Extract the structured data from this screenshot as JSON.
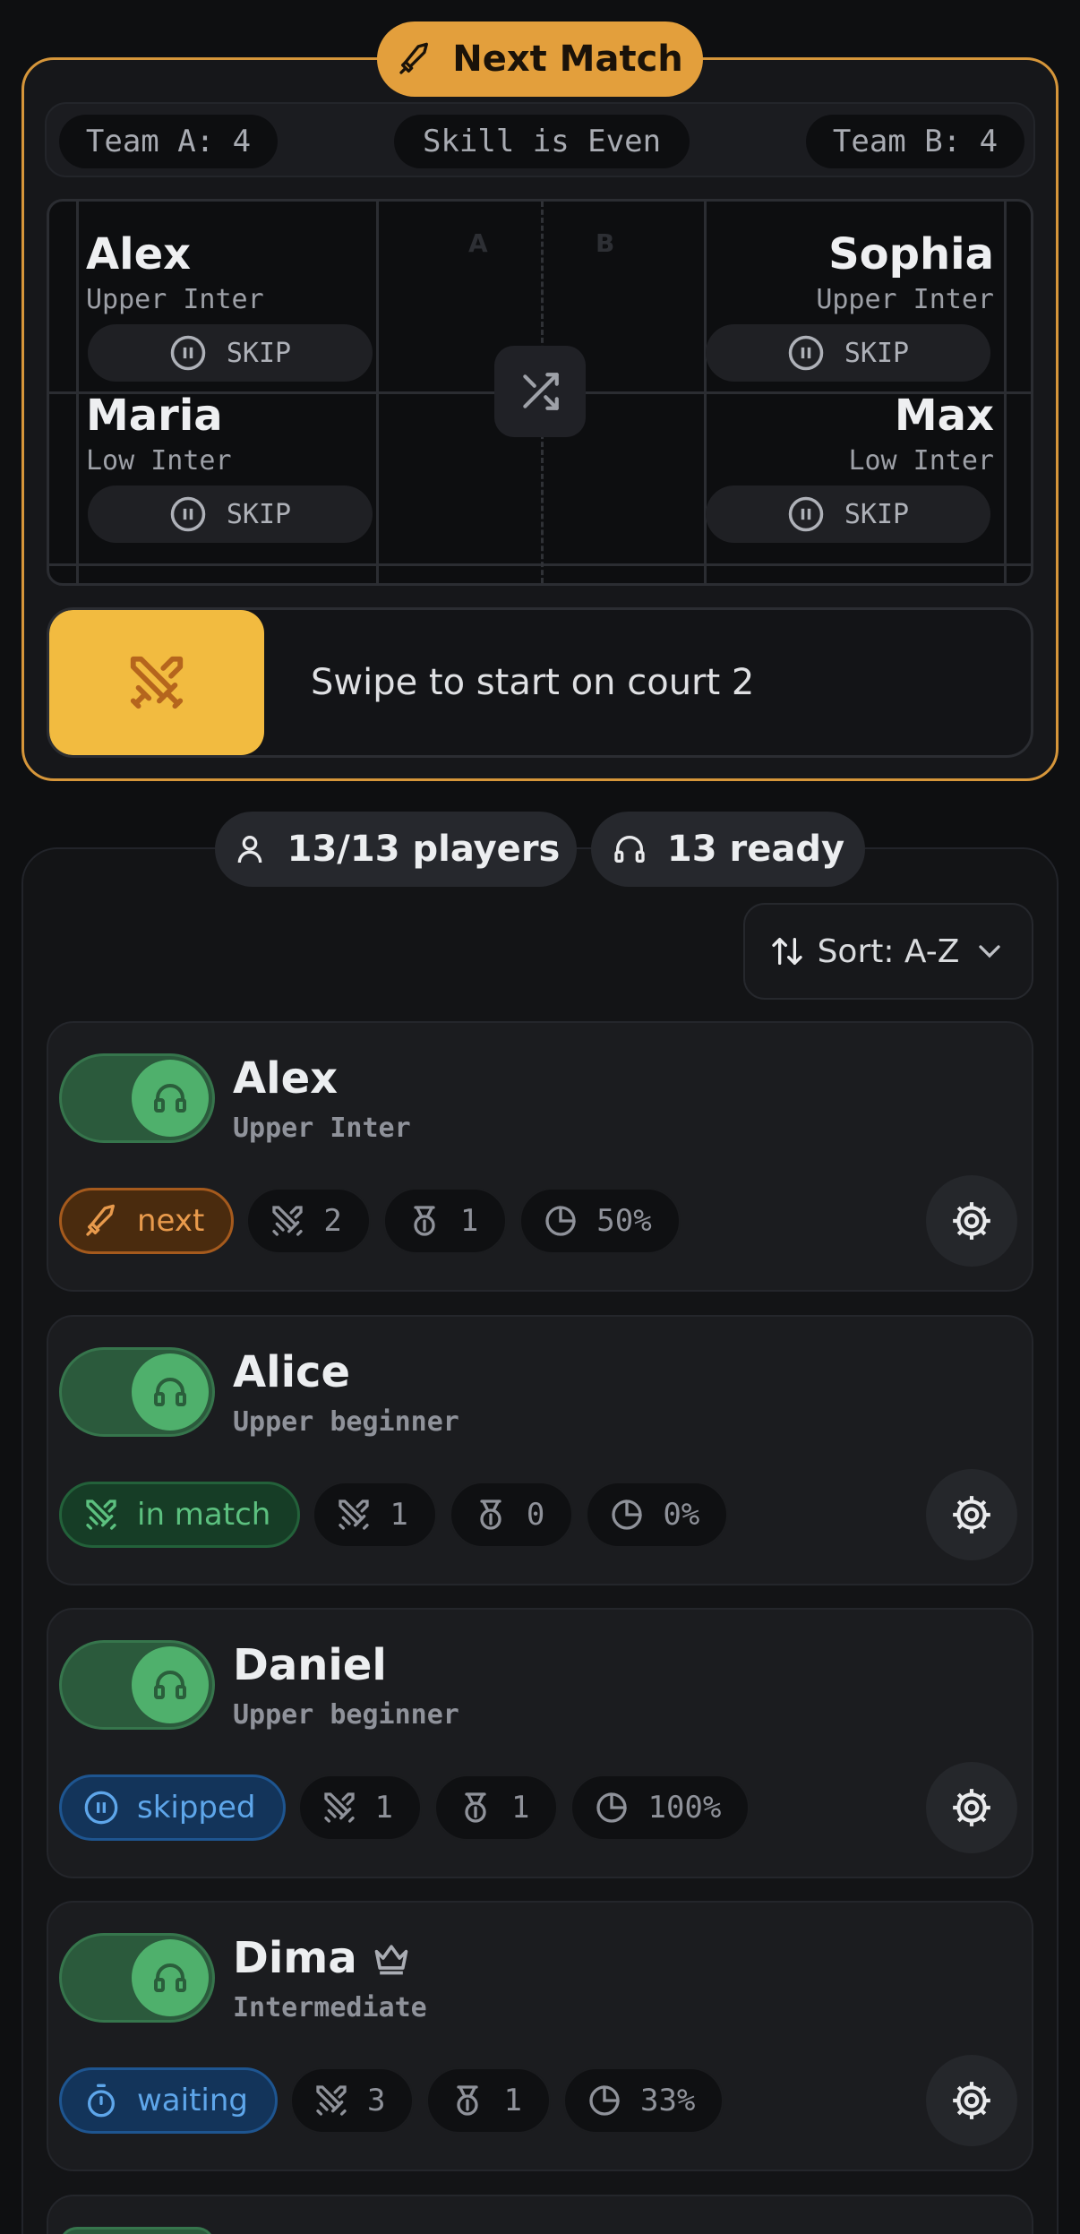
{
  "match": {
    "title": "Next Match",
    "team_a": "Team A: 4",
    "balance": "Skill is Even",
    "team_b": "Team B: 4",
    "court_labels": [
      "A",
      "B"
    ],
    "left_players": [
      {
        "name": "Alex",
        "level": "Upper Inter",
        "skip": "SKIP"
      },
      {
        "name": "Maria",
        "level": "Low Inter",
        "skip": "SKIP"
      }
    ],
    "right_players": [
      {
        "name": "Sophia",
        "level": "Upper Inter",
        "skip": "SKIP"
      },
      {
        "name": "Max",
        "level": "Low Inter",
        "skip": "SKIP"
      }
    ],
    "swipe_text": "Swipe to start on court 2"
  },
  "summary": {
    "players": "13/13 players",
    "ready": "13 ready",
    "sort": "Sort: A-Z"
  },
  "players": [
    {
      "name": "Alex",
      "level": "Upper Inter",
      "status": "next",
      "matches": "2",
      "wins": "1",
      "rate": "50%"
    },
    {
      "name": "Alice",
      "level": "Upper beginner",
      "status": "in match",
      "matches": "1",
      "wins": "0",
      "rate": "0%"
    },
    {
      "name": "Daniel",
      "level": "Upper beginner",
      "status": "skipped",
      "matches": "1",
      "wins": "1",
      "rate": "100%"
    },
    {
      "name": "Dima",
      "level": "Intermediate",
      "status": "waiting",
      "matches": "3",
      "wins": "1",
      "rate": "33%",
      "badge": "crown-icon"
    }
  ],
  "colors": {
    "accent": "#e39f3c",
    "swipe": "#f2bb40",
    "ready_green": "#4fb06c",
    "status_next": "#e89a4c",
    "status_in_match": "#5cc07f",
    "status_blue": "#5ea6ea"
  }
}
